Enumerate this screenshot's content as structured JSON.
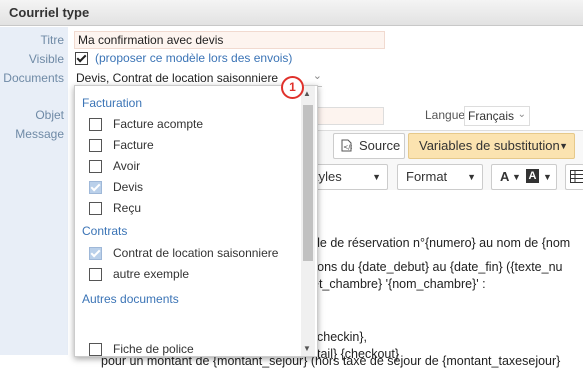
{
  "header": {
    "title": "Courriel type"
  },
  "labels": {
    "titre": "Titre",
    "visible": "Visible",
    "documents": "Documents",
    "objet": "Objet",
    "message": "Message"
  },
  "titre_value": "Ma confirmation avec devis",
  "visible": {
    "checked": true,
    "note": "(proposer ce modèle lors des envois)"
  },
  "documents_value": "Devis, Contrat de location saisonniere",
  "badge": "1",
  "langue": {
    "label": "Langue",
    "value": "Français"
  },
  "toolbar": {
    "source_label": "Source",
    "substitution_label": "Variables de substitution",
    "styles_label": "tyles",
    "format_label": "Format",
    "text_color_letter": "A",
    "bg_color_letter": "A"
  },
  "editor_lines": [
    "nde de réservation n°{numero} au nom de {nom",
    "erons du {date_debut} au {date_fin} ({texte_nu",
    "et_chambre} '{nom_chambre}' :",
    "checkin},",
    "tail} {checkout}",
    "pour un montant de {montant_sejour} (hors taxe de séjour de {montant_taxesejour}"
  ],
  "dropdown": {
    "groups": [
      {
        "name": "Facturation",
        "items": [
          {
            "label": "Facture acompte",
            "checked": false
          },
          {
            "label": "Facture",
            "checked": false
          },
          {
            "label": "Avoir",
            "checked": false
          },
          {
            "label": "Devis",
            "checked": true
          },
          {
            "label": "Reçu",
            "checked": false
          }
        ]
      },
      {
        "name": "Contrats",
        "items": [
          {
            "label": "Contrat de location saisonniere",
            "checked": true
          },
          {
            "label": "autre exemple",
            "checked": false
          }
        ]
      },
      {
        "name": "Autres documents",
        "items": [
          {
            "label": "Fiche de police",
            "checked": false
          }
        ]
      }
    ]
  }
}
